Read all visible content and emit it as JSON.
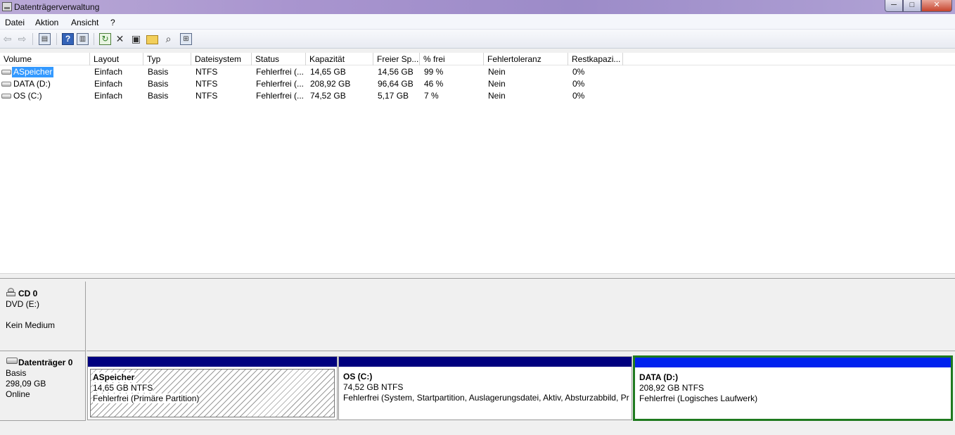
{
  "window": {
    "title": "Datenträgerverwaltung",
    "min_glyph": "─",
    "max_glyph": "□",
    "close_glyph": "✕"
  },
  "menu": [
    "Datei",
    "Aktion",
    "Ansicht",
    "?"
  ],
  "toolbar_icons": {
    "back": "back-arrow-icon",
    "forward": "forward-arrow-icon",
    "show_hide_tree": "console-tree-icon",
    "help": "help-icon",
    "help_glyph": "?",
    "show_action_pane": "action-pane-icon",
    "refresh": "refresh-icon",
    "delete": "delete-icon",
    "properties": "properties-icon",
    "open": "open-folder-icon",
    "explore": "explore-icon",
    "disk_settings": "disk-settings-icon"
  },
  "volume_list": {
    "columns": [
      "Volume",
      "Layout",
      "Typ",
      "Dateisystem",
      "Status",
      "Kapazität",
      "Freier Sp...",
      "% frei",
      "Fehlertoleranz",
      "Restkapazi..."
    ],
    "rows": [
      {
        "volume": "ASpeicher",
        "layout": "Einfach",
        "typ": "Basis",
        "dateisystem": "NTFS",
        "status": "Fehlerfrei (...",
        "kapazitaet": "14,65 GB",
        "frei": "14,56 GB",
        "prozent_frei": "99 %",
        "fehlertoleranz": "Nein",
        "restkapazitaet": "0%",
        "selected": true
      },
      {
        "volume": "DATA (D:)",
        "layout": "Einfach",
        "typ": "Basis",
        "dateisystem": "NTFS",
        "status": "Fehlerfrei (...",
        "kapazitaet": "208,92 GB",
        "frei": "96,64 GB",
        "prozent_frei": "46 %",
        "fehlertoleranz": "Nein",
        "restkapazitaet": "0%",
        "selected": false
      },
      {
        "volume": "OS (C:)",
        "layout": "Einfach",
        "typ": "Basis",
        "dateisystem": "NTFS",
        "status": "Fehlerfrei (...",
        "kapazitaet": "74,52 GB",
        "frei": "5,17 GB",
        "prozent_frei": "7 %",
        "fehlertoleranz": "Nein",
        "restkapazitaet": "0%",
        "selected": false
      }
    ]
  },
  "disks": {
    "cd0": {
      "name": "CD 0",
      "drive": "DVD (E:)",
      "media": "Kein Medium"
    },
    "disk0": {
      "name": "Datenträger 0",
      "type": "Basis",
      "size": "298,09 GB",
      "state": "Online",
      "partitions": [
        {
          "name": "ASpeicher",
          "size": "14,65 GB NTFS",
          "status": "Fehlerfrei (Primäre Partition)"
        },
        {
          "name": "OS  (C:)",
          "size": "74,52 GB NTFS",
          "status": "Fehlerfrei (System, Startpartition, Auslagerungsdatei, Aktiv, Absturzabbild, Pr"
        },
        {
          "name": "DATA  (D:)",
          "size": "208,92 GB NTFS",
          "status": "Fehlerfrei (Logisches Laufwerk)"
        }
      ]
    }
  }
}
